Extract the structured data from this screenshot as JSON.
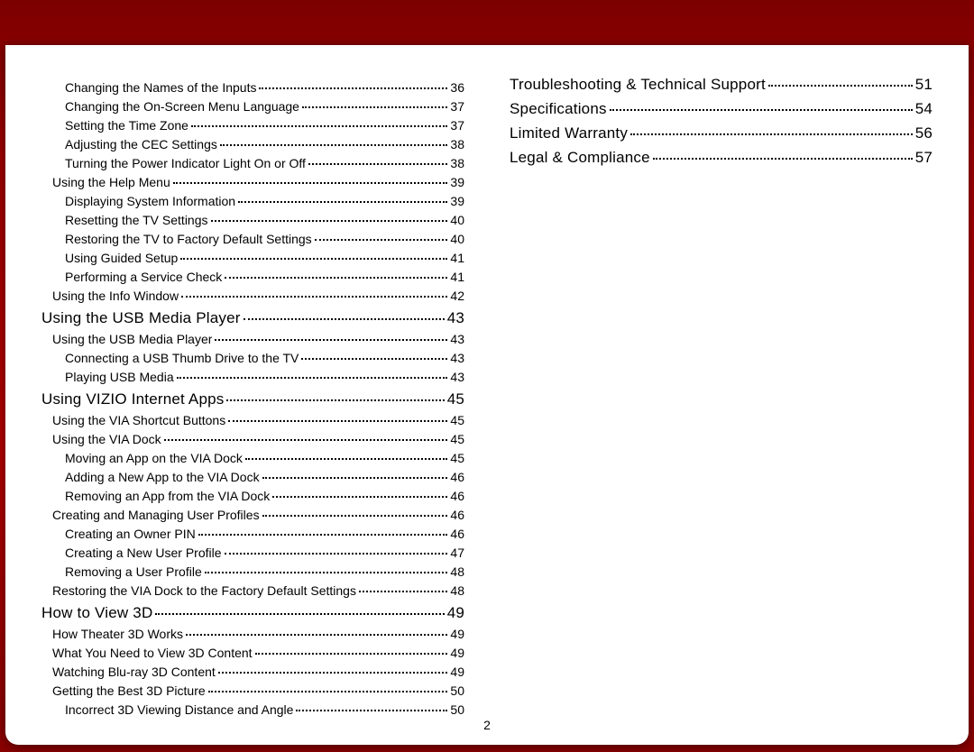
{
  "page_number": "2",
  "toc": [
    {
      "level": 2,
      "title": "Changing the Names of the Inputs",
      "page": "36"
    },
    {
      "level": 2,
      "title": "Changing the On-Screen Menu Language",
      "page": "37"
    },
    {
      "level": 2,
      "title": "Setting the Time Zone",
      "page": "37"
    },
    {
      "level": 2,
      "title": "Adjusting the CEC Settings",
      "page": "38"
    },
    {
      "level": 2,
      "title": "Turning the Power Indicator Light On or Off",
      "page": "38"
    },
    {
      "level": 1,
      "title": "Using the Help Menu",
      "page": "39"
    },
    {
      "level": 2,
      "title": "Displaying System Information",
      "page": "39"
    },
    {
      "level": 2,
      "title": "Resetting the TV Settings",
      "page": "40"
    },
    {
      "level": 2,
      "title": "Restoring the TV to Factory Default Settings",
      "page": "40"
    },
    {
      "level": 2,
      "title": "Using Guided Setup",
      "page": "41"
    },
    {
      "level": 2,
      "title": "Performing a Service Check",
      "page": "41"
    },
    {
      "level": 1,
      "title": "Using the Info Window",
      "page": "42"
    },
    {
      "level": 0,
      "title": "Using the USB Media Player",
      "page": "43"
    },
    {
      "level": 1,
      "title": "Using the USB Media Player",
      "page": "43"
    },
    {
      "level": 2,
      "title": "Connecting a USB Thumb Drive to the TV",
      "page": "43"
    },
    {
      "level": 2,
      "title": "Playing USB Media",
      "page": "43"
    },
    {
      "level": 0,
      "title": "Using VIZIO Internet Apps",
      "page": "45"
    },
    {
      "level": 1,
      "title": "Using the VIA Shortcut Buttons",
      "page": "45"
    },
    {
      "level": 1,
      "title": "Using the VIA Dock",
      "page": "45"
    },
    {
      "level": 2,
      "title": "Moving an App on the VIA Dock",
      "page": "45"
    },
    {
      "level": 2,
      "title": "Adding a New App to the VIA Dock",
      "page": "46"
    },
    {
      "level": 2,
      "title": "Removing an App from the VIA Dock",
      "page": "46"
    },
    {
      "level": 1,
      "title": "Creating and Managing User Profiles",
      "page": "46"
    },
    {
      "level": 2,
      "title": "Creating an Owner PIN",
      "page": "46"
    },
    {
      "level": 2,
      "title": "Creating a New User Profile",
      "page": "47"
    },
    {
      "level": 2,
      "title": "Removing a User Profile",
      "page": "48"
    },
    {
      "level": 1,
      "title": "Restoring the VIA Dock to the Factory Default Settings",
      "page": "48"
    },
    {
      "level": 0,
      "title": "How to View 3D",
      "page": "49"
    },
    {
      "level": 1,
      "title": "How Theater 3D Works",
      "page": "49"
    },
    {
      "level": 1,
      "title": "What You Need to View 3D Content",
      "page": "49"
    },
    {
      "level": 1,
      "title": "Watching Blu-ray 3D Content",
      "page": "49"
    },
    {
      "level": 1,
      "title": "Getting the Best 3D Picture",
      "page": "50"
    },
    {
      "level": 2,
      "title": "Incorrect 3D Viewing Distance and Angle",
      "page": "50"
    },
    {
      "level": 0,
      "title": "Troubleshooting & Technical Support",
      "page": "51"
    },
    {
      "level": 0,
      "title": "Specifications",
      "page": "54"
    },
    {
      "level": 0,
      "title": "Limited Warranty",
      "page": "56"
    },
    {
      "level": 0,
      "title": "Legal & Compliance",
      "page": "57"
    }
  ]
}
